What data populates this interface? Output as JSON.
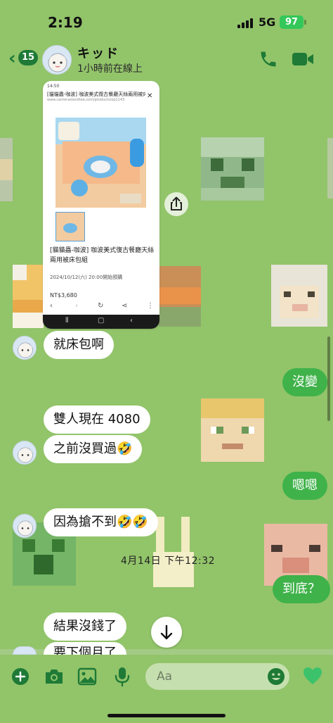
{
  "status_bar": {
    "time": "2:19",
    "network": "5G",
    "battery": "97"
  },
  "header": {
    "back_count": "15",
    "contact_name": "キッド",
    "contact_status": "1小時前在線上"
  },
  "shared_screenshot": {
    "status_time": "14:50",
    "page_title": "[貓貓蟲-咖波] 咖波美式復古餐廳天絲兩用被床...",
    "page_url": "www.cameraslandtee.com/products/op1143",
    "product_name": "[貓貓蟲-咖波] 咖波美式復古餐廳天絲兩用被床包組",
    "preorder_date": "2024/10/12(六) 20:00開始預購",
    "price": "NT$3,680",
    "close_icon": "✕"
  },
  "messages": [
    {
      "side": "in",
      "text": "就床包啊"
    },
    {
      "side": "out",
      "text": "沒變"
    },
    {
      "side": "in",
      "text": "雙人現在 4080"
    },
    {
      "side": "in",
      "text": "之前沒買過🤣"
    },
    {
      "side": "out",
      "text": "嗯嗯"
    },
    {
      "side": "in",
      "text": "因為搶不到🤣🤣"
    },
    {
      "side": "out",
      "text": "到底？"
    },
    {
      "side": "in",
      "text": "結果沒錢了"
    },
    {
      "side": "in",
      "text": "要下個月了"
    }
  ],
  "date_separator": "4月14日 下午12:32",
  "composer": {
    "placeholder": "Aa"
  },
  "colors": {
    "background": "#92c46a",
    "accent": "#1e7a36",
    "outgoing_bubble": "#3fb24a",
    "incoming_bubble": "#ffffff"
  },
  "icons": [
    "back-chevron-icon",
    "phone-icon",
    "video-camera-icon",
    "share-icon",
    "plus-icon",
    "camera-icon",
    "image-icon",
    "microphone-icon",
    "emoji-icon",
    "heart-icon",
    "arrow-down-icon"
  ]
}
